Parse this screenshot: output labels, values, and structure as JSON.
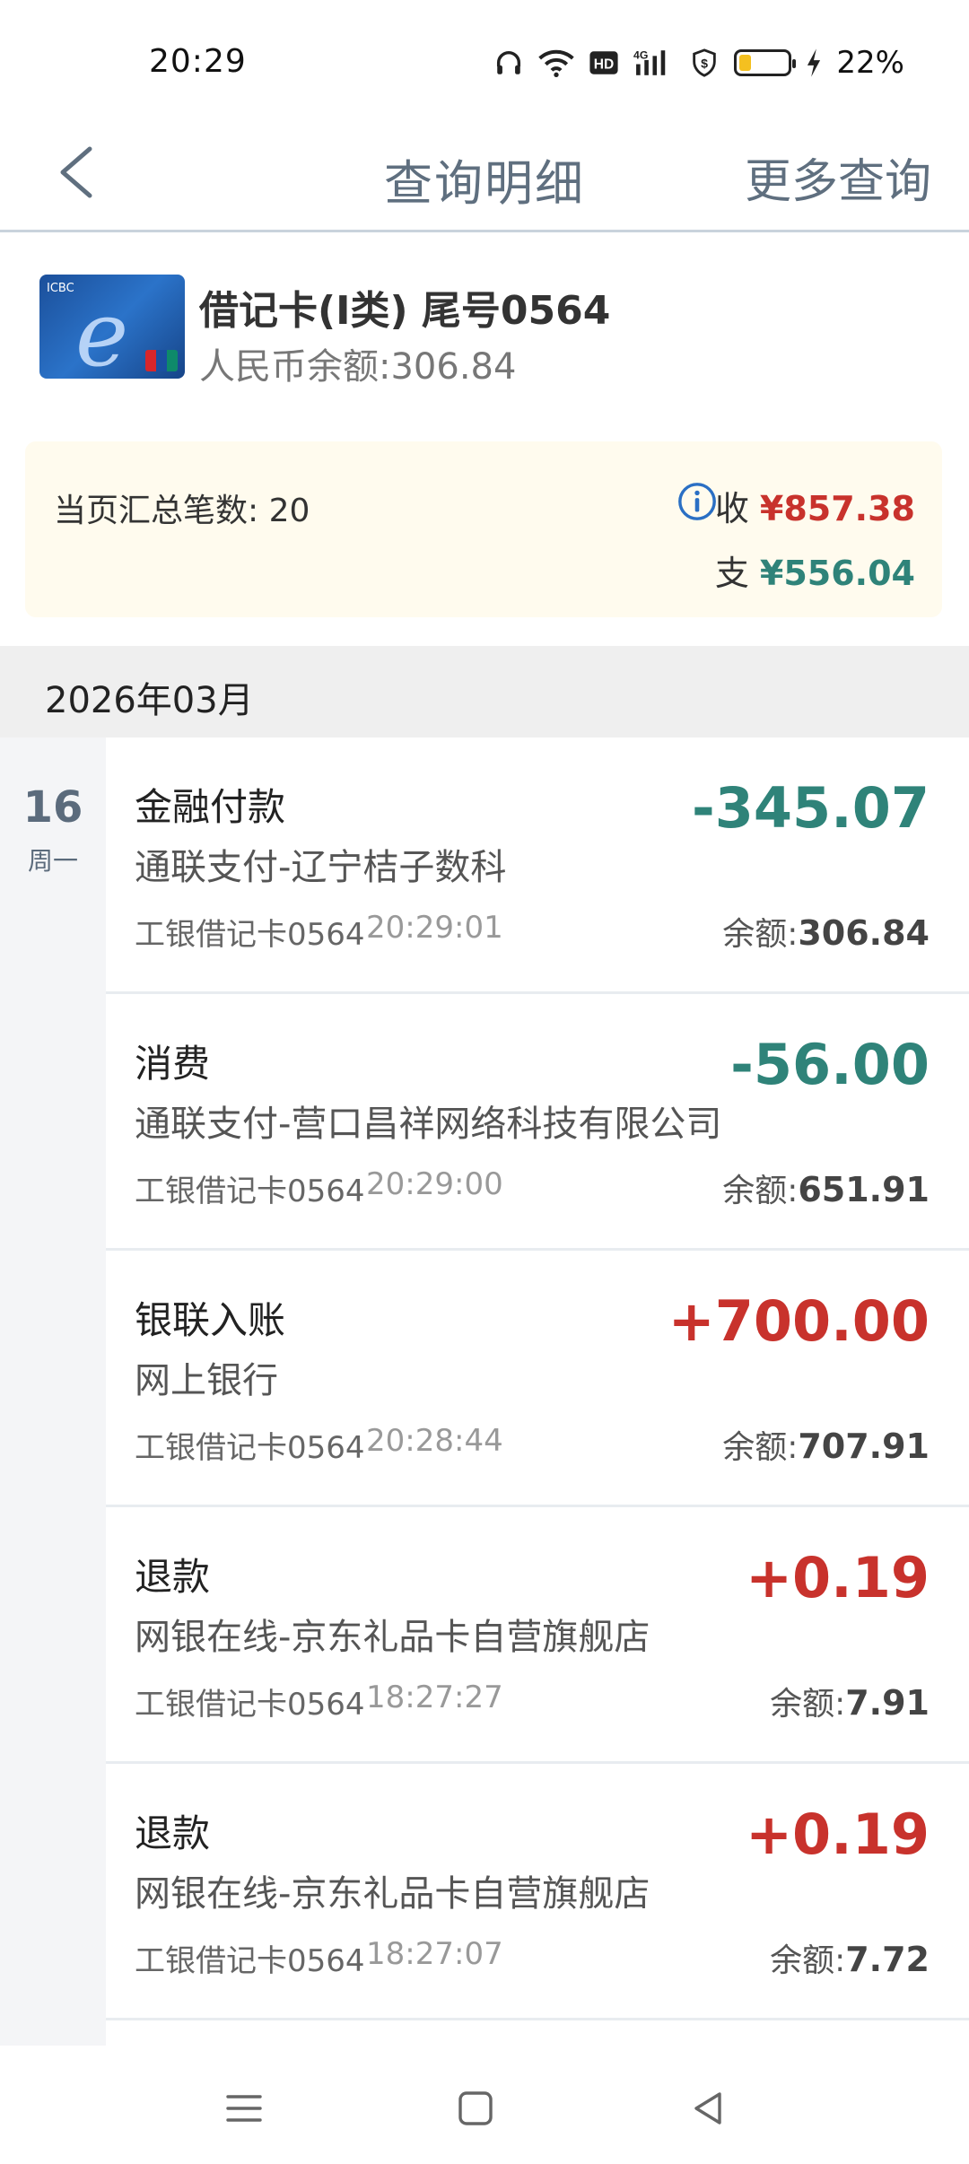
{
  "status_bar": {
    "time": "20:29",
    "battery_pct": "22%",
    "battery_level": 0.22
  },
  "nav": {
    "title": "查询明细",
    "more": "更多查询"
  },
  "account": {
    "name": "借记卡(I类) 尾号0564",
    "balance": "人民币余额:306.84"
  },
  "summary": {
    "count_label": "当页汇总笔数: 20",
    "in_label": "收",
    "in_amount": "¥857.38",
    "out_label": "支",
    "out_amount": "¥556.04"
  },
  "month": "2026年03月",
  "date_col": {
    "day": "16",
    "weekday": "周一"
  },
  "transactions": [
    {
      "type": "金融付款",
      "desc": "通联支付-辽宁桔子数科",
      "account": "工银借记卡0564",
      "time": "20:29:01",
      "amount": "-345.07",
      "direction": "out",
      "balance_label": "余额:",
      "balance": "306.84"
    },
    {
      "type": "消费",
      "desc": "通联支付-营口昌祥网络科技有限公司",
      "account": "工银借记卡0564",
      "time": "20:29:00",
      "amount": "-56.00",
      "direction": "out",
      "balance_label": "余额:",
      "balance": "651.91"
    },
    {
      "type": "银联入账",
      "desc": "网上银行",
      "account": "工银借记卡0564",
      "time": "20:28:44",
      "amount": "+700.00",
      "direction": "in",
      "balance_label": "余额:",
      "balance": "707.91"
    },
    {
      "type": "退款",
      "desc": "网银在线-京东礼品卡自营旗舰店",
      "account": "工银借记卡0564",
      "time": "18:27:27",
      "amount": "+0.19",
      "direction": "in",
      "balance_label": "余额:",
      "balance": "7.91"
    },
    {
      "type": "退款",
      "desc": "网银在线-京东礼品卡自营旗舰店",
      "account": "工银借记卡0564",
      "time": "18:27:07",
      "amount": "+0.19",
      "direction": "in",
      "balance_label": "余额:",
      "balance": "7.72"
    }
  ],
  "colors": {
    "income": "#c8322c",
    "expense": "#2f8379",
    "summary_bg": "#fffbee"
  }
}
